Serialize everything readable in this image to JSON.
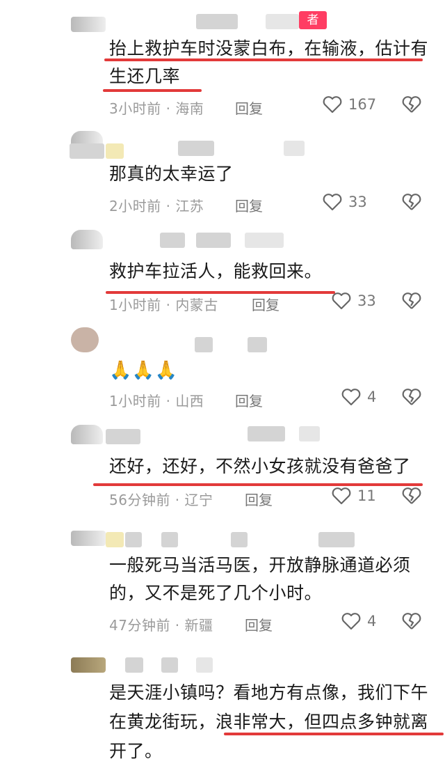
{
  "comments": [
    {
      "badge": "者",
      "text": "抬上救护车时没蒙白布，在输液，估计有生还几率",
      "time": "3小时前",
      "location": "海南",
      "reply": "回复",
      "likes": "167"
    },
    {
      "text": "那真的太幸运了",
      "time": "2小时前",
      "location": "江苏",
      "reply": "回复",
      "likes": "33"
    },
    {
      "text": "救护车拉活人，能救回来。",
      "time": "1小时前",
      "location": "内蒙古",
      "reply": "回复",
      "likes": "33"
    },
    {
      "text": "🙏🙏🙏",
      "time": "1小时前",
      "location": "山西",
      "reply": "回复",
      "likes": "4"
    },
    {
      "text": "还好，还好，不然小女孩就没有爸爸了",
      "time": "56分钟前",
      "location": "辽宁",
      "reply": "回复",
      "likes": "11"
    },
    {
      "text": "一般死马当活马医，开放静脉通道必须的，又不是死了几个小时。",
      "time": "47分钟前",
      "location": "新疆",
      "reply": "回复",
      "likes": "4"
    },
    {
      "text": "是天涯小镇吗？看地方有点像，我们下午在黄龙街玩，浪非常大，但四点多钟就离开了。"
    }
  ],
  "colors": {
    "underline": "#e23a3a",
    "badge": "#ff3d63"
  }
}
